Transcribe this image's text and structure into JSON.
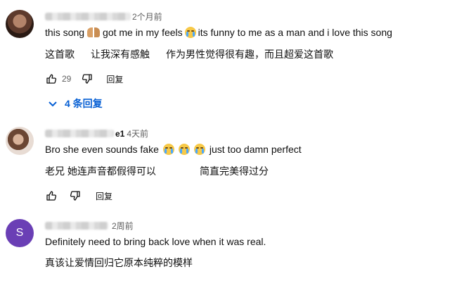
{
  "comments": [
    {
      "time": "2个月前",
      "text_before": "this song",
      "text_middle": "got me in my feels",
      "text_after": "its funny to me as a man and i love this song",
      "cn1": "这首歌",
      "cn2": "让我深有感触",
      "cn3": "作为男性觉得很有趣，而且超爱这首歌",
      "likes": "29",
      "reply_label": "回复",
      "replies_toggle": "4 条回复"
    },
    {
      "name_suffix": "e1",
      "time": "4天前",
      "text_before": "Bro she even sounds fake",
      "text_after": "just too damn perfect",
      "cn1": "老兄 她连声音都假得可以",
      "cn2": "简直完美得过分",
      "reply_label": "回复"
    },
    {
      "avatar_letter": "S",
      "time": "2周前",
      "text": "Definitely need to bring back love when it was real.",
      "cn1": "真该让爱情回归它原本纯粹的模样"
    }
  ],
  "colors": {
    "link_blue": "#065fd4",
    "avatar_purple": "#6a3fb5",
    "secondary_text": "#606060"
  }
}
